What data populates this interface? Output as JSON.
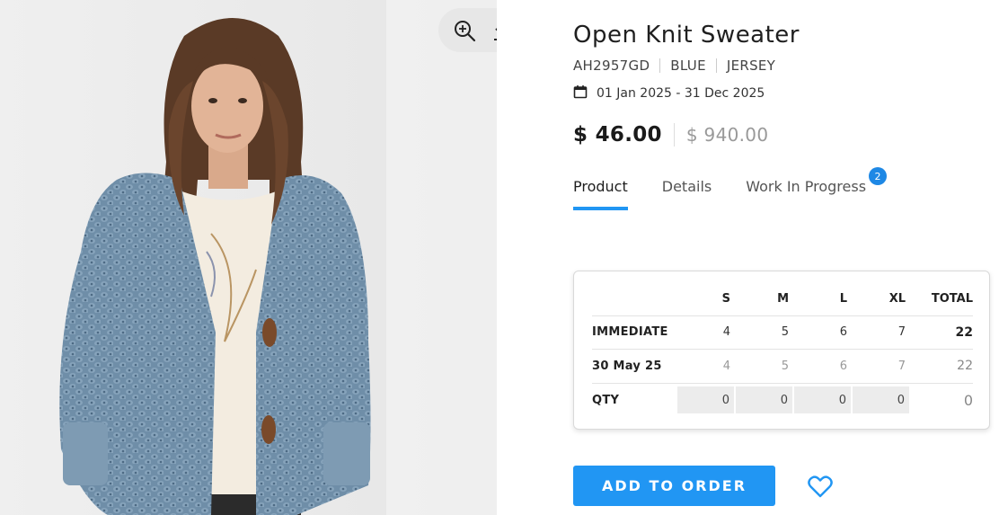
{
  "product": {
    "title": "Open Knit Sweater",
    "code": "AH2957GD",
    "color": "BLUE",
    "fabric": "JERSEY",
    "date_range": "01 Jan 2025 - 31 Dec 2025",
    "price": "$ 46.00",
    "alt_price": "$ 940.00"
  },
  "image_tools": {
    "zoom_icon": "zoom-in-icon",
    "download_icon": "download-icon"
  },
  "tabs": [
    {
      "label": "Product",
      "active": true
    },
    {
      "label": "Details",
      "active": false
    },
    {
      "label": "Work In Progress",
      "active": false,
      "badge": "2"
    }
  ],
  "sizes": {
    "headers": [
      "S",
      "M",
      "L",
      "XL",
      "TOTAL"
    ],
    "rows": [
      {
        "label": "IMMEDIATE",
        "values": [
          "4",
          "5",
          "6",
          "7"
        ],
        "total": "22"
      },
      {
        "label": "30 May 25",
        "values": [
          "4",
          "5",
          "6",
          "7"
        ],
        "total": "22"
      }
    ],
    "qty": {
      "label": "QTY",
      "values": [
        "0",
        "0",
        "0",
        "0"
      ],
      "total": "0"
    }
  },
  "actions": {
    "add_label": "ADD TO ORDER",
    "wishlist_icon": "heart-icon"
  },
  "colors": {
    "accent": "#2196f3",
    "badge": "#1e88e5",
    "sweater": "#6f8ea8"
  }
}
